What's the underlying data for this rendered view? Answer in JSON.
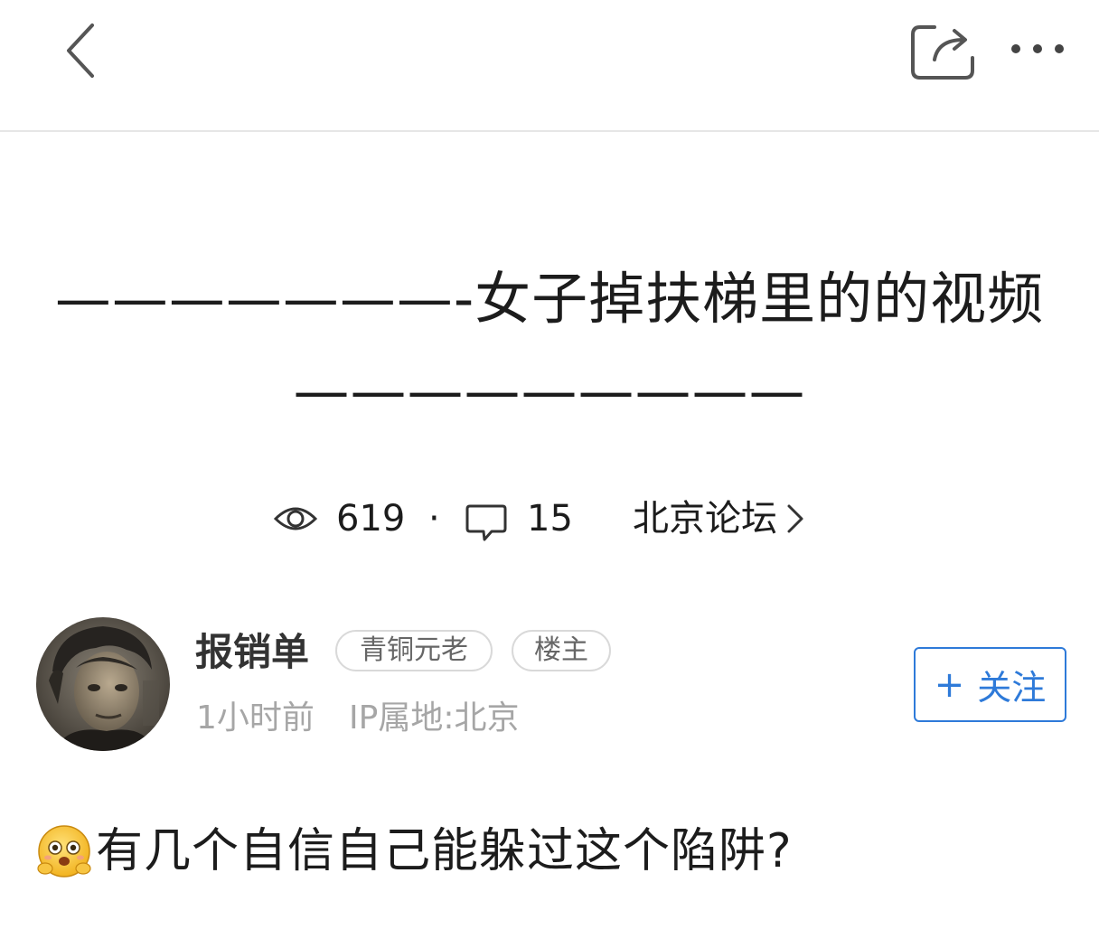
{
  "topbar": {
    "back_icon": "chevron-left-icon",
    "share_icon": "share-icon",
    "more_icon": "more-dots-icon"
  },
  "post": {
    "title": "———————-女子掉扶梯里的的视频—————————",
    "views": "619",
    "separator": "·",
    "comments": "15",
    "forum": "北京论坛",
    "body": "有几个自信自己能躲过这个陷阱?",
    "body_emoji": "scared-face-emoji-icon"
  },
  "author": {
    "name": "报销单",
    "badges": [
      "青铜元老",
      "楼主"
    ],
    "time": "1小时前",
    "ip": "IP属地:北京",
    "follow_label": "关注",
    "follow_plus": "+"
  },
  "colors": {
    "accent": "#2e7ad9",
    "muted_text": "#a6a6a6",
    "divider": "#e6e6e6"
  }
}
